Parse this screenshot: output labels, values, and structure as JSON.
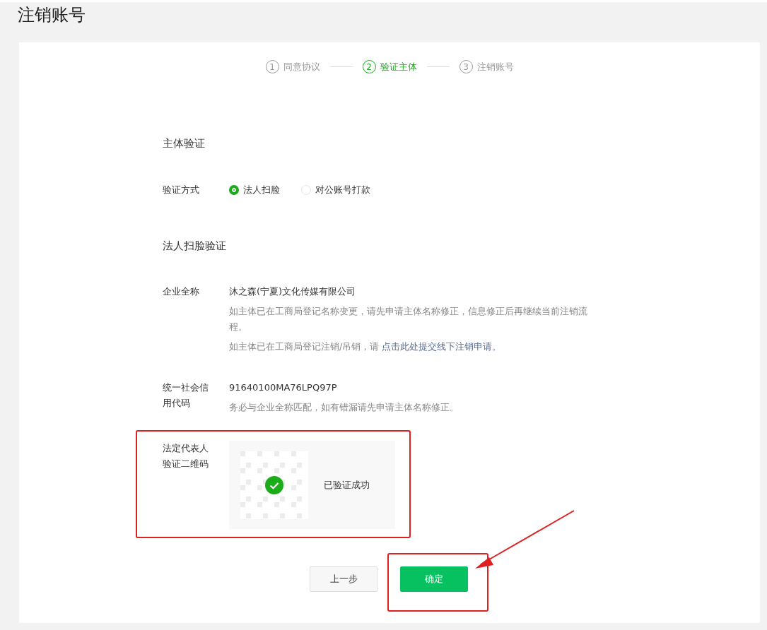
{
  "page": {
    "title": "注销账号"
  },
  "steps": [
    {
      "number": "1",
      "label": "同意协议",
      "selected": false
    },
    {
      "number": "2",
      "label": "验证主体",
      "selected": true
    },
    {
      "number": "3",
      "label": "注销账号",
      "selected": false
    }
  ],
  "section_title": "主体验证",
  "verify_method": {
    "label": "验证方式",
    "options": [
      {
        "label": "法人扫脸",
        "selected": true
      },
      {
        "label": "对公账号打款",
        "selected": false
      }
    ]
  },
  "subsection_title": "法人扫脸验证",
  "company": {
    "label": "企业全称",
    "value": "沐之森(宁夏)文化传媒有限公司",
    "hints": [
      {
        "text": "如主体已在工商局登记名称变更，请先申请主体名称修正，信息修正后再继续当前注销流程。"
      },
      {
        "text": "如主体已在工商局登记注销/吊销，请 ",
        "link": "点击此处提交线下注销申请。"
      }
    ]
  },
  "credit_code": {
    "label": "统一社会信用代码",
    "value": "91640100MA76LPQ97P",
    "hint": "务必与企业全称匹配，如有错漏请先申请主体名称修正。"
  },
  "qr_verify": {
    "label": "法定代表人验证二维码",
    "status": "已验证成功",
    "verified": true
  },
  "buttons": [
    {
      "label": "上一步",
      "kind": "secondary"
    },
    {
      "label": "确定",
      "kind": "primary"
    }
  ]
}
